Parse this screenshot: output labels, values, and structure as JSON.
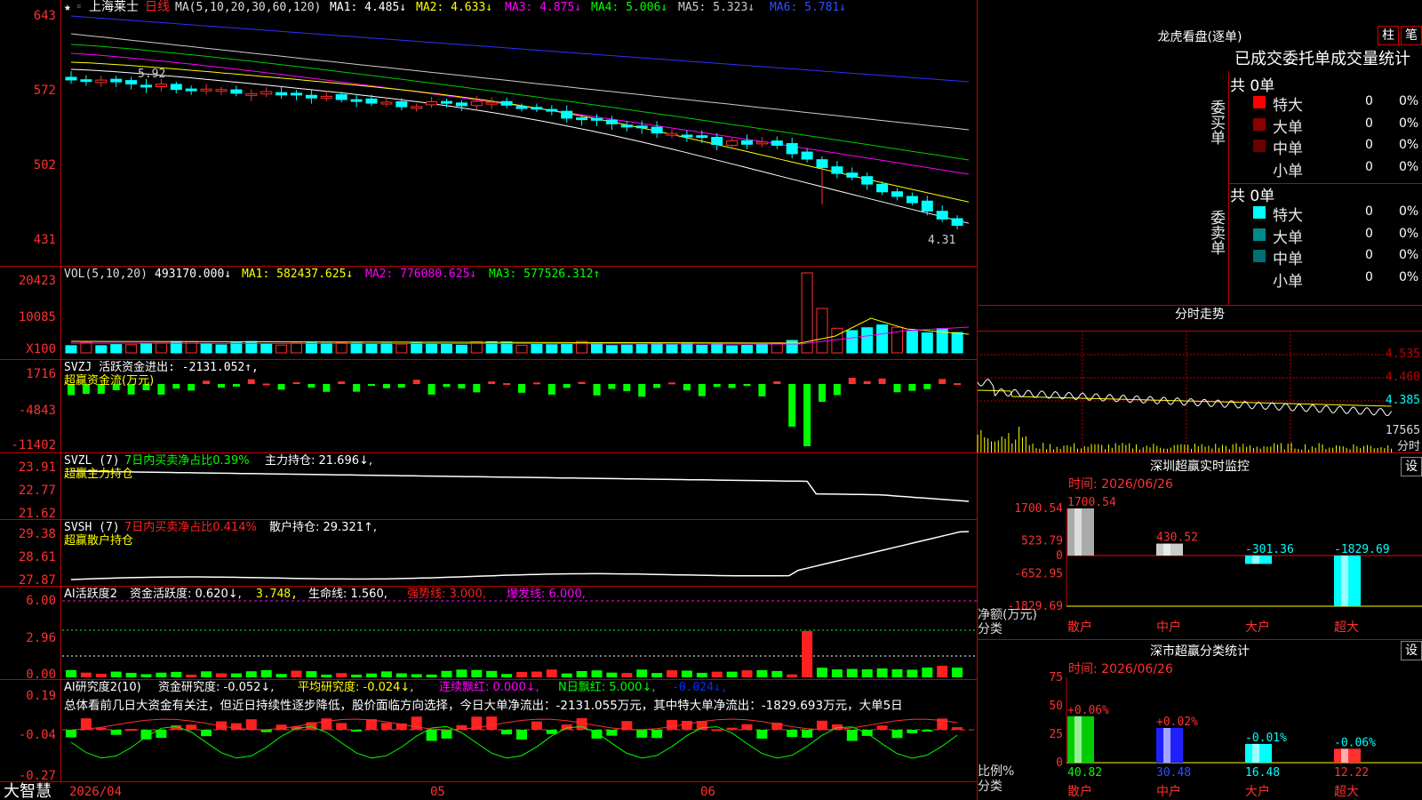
{
  "stock": {
    "name": "上海莱士",
    "period": "日线",
    "star": "★"
  },
  "ma_line": {
    "label": "MA(5,10,20,30,60,120)",
    "ma1": "MA1: 4.485↓",
    "ma2": "MA2: 4.633↓",
    "ma3": "MA3: 4.875↓",
    "ma4": "MA4: 5.006↓",
    "ma5": "MA5: 5.323↓",
    "ma6": "MA6: 5.781↓"
  },
  "price_axis": [
    "643",
    "572",
    "502",
    "431"
  ],
  "price_marks": {
    "high": "5.92",
    "low": "4.31"
  },
  "vol": {
    "label": "VOL(5,10,20)",
    "value": "493170.000↓",
    "ma1": "MA1: 582437.625↓",
    "ma2": "MA2: 776080.625↓",
    "ma3": "MA3: 577526.312↑",
    "axis": [
      "20423",
      "10085",
      "X100"
    ]
  },
  "svzj": {
    "label": "SVZJ  活跃资金进出: -2131.052↑,",
    "sub": "超赢资金流(万元)",
    "axis": [
      "1716",
      "-4843",
      "-11402"
    ]
  },
  "svzl": {
    "label": "SVZL (7)",
    "desc": "7日内买卖净占比0.39%",
    "hold": "主力持仓: 21.696↓,",
    "sub": "超赢主力持仓",
    "axis": [
      "23.91",
      "22.77",
      "21.62"
    ]
  },
  "svsh": {
    "label": "SVSH (7)",
    "desc": "7日内买卖净占比0.414%",
    "hold": "散户持仓: 29.321↑,",
    "sub": "超赢散户持仓",
    "axis": [
      "29.38",
      "28.61",
      "27.87"
    ]
  },
  "ai_active": {
    "label": "AI活跃度2",
    "v1": "资金活跃度: 0.620↓,",
    "v2": "3.748,",
    "v3": "生命线: 1.560,",
    "v4": "强势线: 3.000,",
    "v5": "爆发线: 6.000,",
    "axis": [
      "6.00",
      "2.96",
      "0.00"
    ]
  },
  "ai_research": {
    "label": "AI研究度2(10)",
    "v1": "资金研究度: -0.052↓,",
    "v2": "平均研究度: -0.024↓,",
    "v3": "连续飘红: 0.000↓,",
    "v4": "N日飘红: 5.000↓,",
    "v5": "-0.024↓,",
    "summary": "总体看前几日大资金有关注，但近日持续性逐步降低，股价面临方向选择，今日大单净流出：-2131.055万元，其中特大单净流出：-1829.693万元，大单5日",
    "axis": [
      "0.19",
      "-0.04",
      "-0.27"
    ]
  },
  "date_axis": {
    "d1": "2026/04",
    "d2": "05",
    "d3": "06"
  },
  "brand": "大智慧",
  "right": {
    "title": "龙虎看盘(逐单)",
    "btn_zhu": "柱",
    "btn_bi": "笔",
    "stats_title": "已成交委托单成交量统计",
    "buy_group": {
      "label": "委买单",
      "total": "共 0单",
      "rows": [
        {
          "name": "特大",
          "count": "0",
          "pct": "0%",
          "color": "#ff0000"
        },
        {
          "name": "大单",
          "count": "0",
          "pct": "0%",
          "color": "#8b0000"
        },
        {
          "name": "中单",
          "count": "0",
          "pct": "0%",
          "color": "#6a0000"
        },
        {
          "name": "小单",
          "count": "0",
          "pct": "0%",
          "color": "#000000"
        }
      ]
    },
    "sell_group": {
      "label": "委卖单",
      "total": "共 0单",
      "rows": [
        {
          "name": "特大",
          "count": "0",
          "pct": "0%",
          "color": "#00ffff"
        },
        {
          "name": "大单",
          "count": "0",
          "pct": "0%",
          "color": "#008b8b"
        },
        {
          "name": "中单",
          "count": "0",
          "pct": "0%",
          "color": "#007070"
        },
        {
          "name": "小单",
          "count": "0",
          "pct": "0%",
          "color": "#000000"
        }
      ]
    },
    "intraday": {
      "title": "分时走势",
      "axis": [
        "4.535",
        "4.460",
        "4.385"
      ],
      "vol_label": "17565",
      "vol_unit": "分时"
    },
    "sz_monitor": {
      "title": "深圳超赢实时监控",
      "btn": "设",
      "time": "时间: 2026/06/26",
      "axis": [
        "1700.54",
        "523.79",
        "0",
        "-652.95",
        "-1829.69"
      ],
      "ylabel": "净额(万元)",
      "xlabel": "分类",
      "categories": [
        "散户",
        "中户",
        "大户",
        "超大"
      ],
      "value_labels": [
        "1700.54",
        "430.52",
        "-301.36",
        "-1829.69"
      ]
    },
    "sz_class": {
      "title": "深市超赢分类统计",
      "btn": "设",
      "time": "时间: 2026/06/26",
      "axis": [
        "75",
        "50",
        "25",
        "0"
      ],
      "ylabel": "比例%",
      "xlabel": "分类",
      "categories": [
        "散户",
        "中户",
        "大户",
        "超大"
      ],
      "pct_labels": [
        "+0.06%",
        "+0.02%",
        "-0.01%",
        "-0.06%"
      ],
      "values": [
        "40.82",
        "30.48",
        "16.48",
        "12.22"
      ]
    }
  },
  "chart_data": [
    {
      "type": "bar",
      "title": "深圳超赢实时监控",
      "xlabel": "分类",
      "ylabel": "净额(万元)",
      "categories": [
        "散户",
        "中户",
        "大户",
        "超大"
      ],
      "values": [
        1700.54,
        430.52,
        -301.36,
        -1829.69
      ],
      "ylim": [
        -1829.69,
        1700.54
      ]
    },
    {
      "type": "bar",
      "title": "深市超赢分类统计",
      "xlabel": "分类",
      "ylabel": "比例%",
      "categories": [
        "散户",
        "中户",
        "大户",
        "超大"
      ],
      "values": [
        40.82,
        30.48,
        16.48,
        12.22
      ],
      "ylim": [
        0,
        75
      ]
    }
  ]
}
